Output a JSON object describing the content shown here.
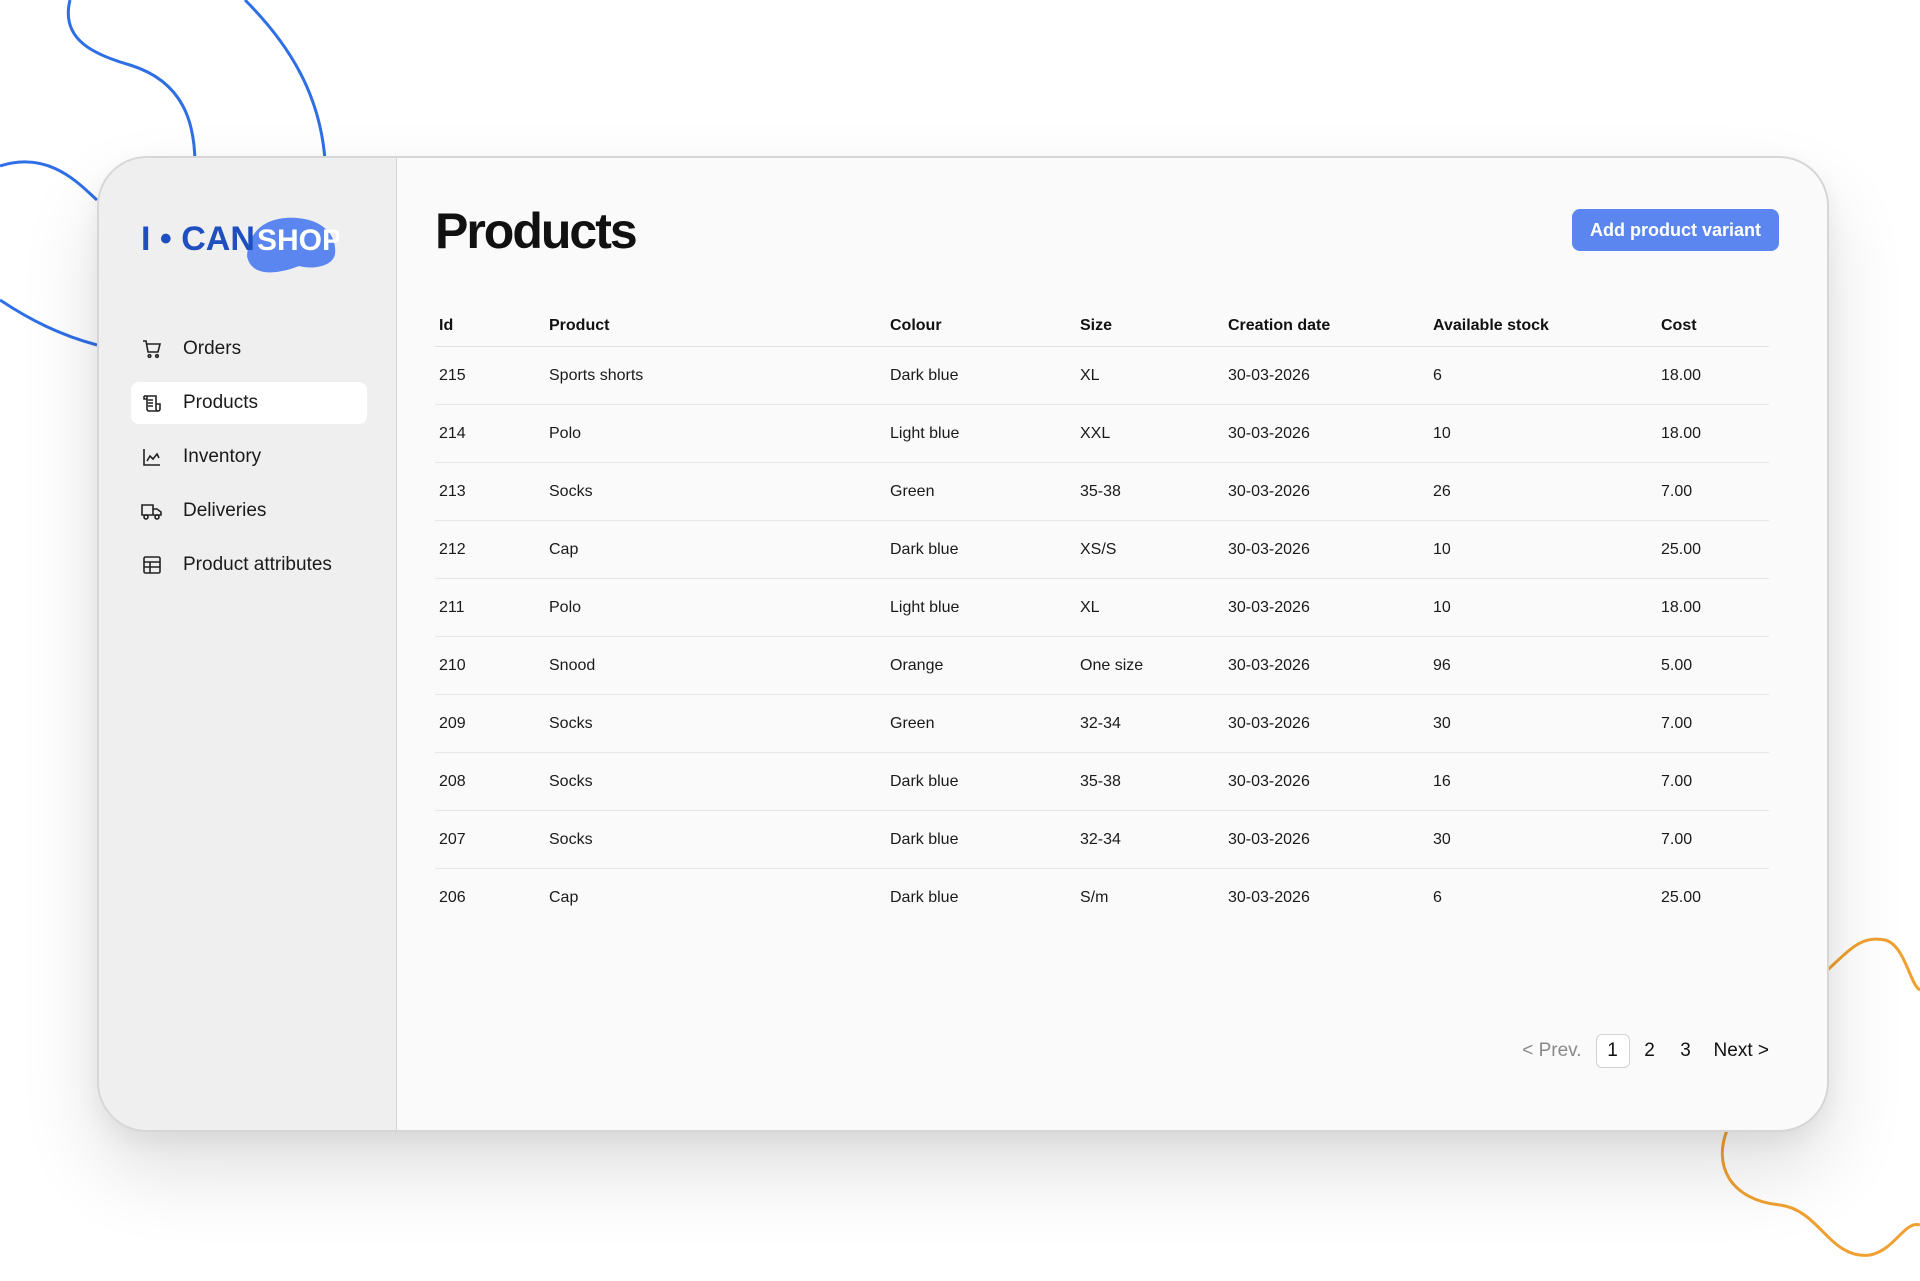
{
  "brand": {
    "logo_left": "I • CAN",
    "logo_right": "SHOP",
    "logo_color": "#1f4fbf",
    "cap_color": "#5b86f0"
  },
  "sidebar": {
    "items": [
      {
        "label": "Orders",
        "icon": "cart-icon"
      },
      {
        "label": "Products",
        "icon": "receipt-icon",
        "active": true
      },
      {
        "label": "Inventory",
        "icon": "chart-icon"
      },
      {
        "label": "Deliveries",
        "icon": "truck-icon"
      },
      {
        "label": "Product attributes",
        "icon": "table-icon"
      }
    ]
  },
  "main": {
    "title": "Products",
    "add_button": "Add product variant",
    "accent_color": "#5b86f0"
  },
  "table": {
    "columns": [
      "Id",
      "Product",
      "Colour",
      "Size",
      "Creation date",
      "Available stock",
      "Cost"
    ],
    "rows": [
      [
        "215",
        "Sports shorts",
        "Dark blue",
        "XL",
        "30-03-2026",
        "6",
        "18.00"
      ],
      [
        "214",
        "Polo",
        "Light blue",
        "XXL",
        "30-03-2026",
        "10",
        "18.00"
      ],
      [
        "213",
        "Socks",
        "Green",
        "35-38",
        "30-03-2026",
        "26",
        "7.00"
      ],
      [
        "212",
        "Cap",
        "Dark blue",
        "XS/S",
        "30-03-2026",
        "10",
        "25.00"
      ],
      [
        "211",
        "Polo",
        "Light blue",
        "XL",
        "30-03-2026",
        "10",
        "18.00"
      ],
      [
        "210",
        "Snood",
        "Orange",
        "One size",
        "30-03-2026",
        "96",
        "5.00"
      ],
      [
        "209",
        "Socks",
        "Green",
        "32-34",
        "30-03-2026",
        "30",
        "7.00"
      ],
      [
        "208",
        "Socks",
        "Dark blue",
        "35-38",
        "30-03-2026",
        "16",
        "7.00"
      ],
      [
        "207",
        "Socks",
        "Dark blue",
        "32-34",
        "30-03-2026",
        "30",
        "7.00"
      ],
      [
        "206",
        "Cap",
        "Dark blue",
        "S/m",
        "30-03-2026",
        "6",
        "25.00"
      ]
    ]
  },
  "pagination": {
    "prev": "< Prev.",
    "pages": [
      "1",
      "2",
      "3"
    ],
    "current": "1",
    "next": "Next >"
  },
  "decoration_colors": {
    "blue": "#2f6fe6",
    "orange": "#f0a030"
  }
}
